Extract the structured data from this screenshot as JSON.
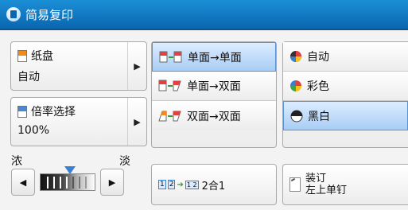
{
  "title": "简易复印",
  "paper": {
    "label": "纸盘",
    "value": "自动"
  },
  "ratio": {
    "label": "倍率选择",
    "value": "100%"
  },
  "sides": {
    "options": [
      {
        "label": "单面→单面",
        "selected": true
      },
      {
        "label": "单面→双面",
        "selected": false
      },
      {
        "label": "双面→双面",
        "selected": false
      }
    ]
  },
  "color": {
    "options": [
      {
        "label": "自动",
        "selected": false
      },
      {
        "label": "彩色",
        "selected": false
      },
      {
        "label": "黑白",
        "selected": true
      }
    ]
  },
  "density": {
    "dark_label": "浓",
    "light_label": "淡",
    "level_fraction": 0.43
  },
  "nup": {
    "icon_text_1": "1",
    "icon_text_2": "2",
    "icon_text_3": "1 2",
    "label": "2合1"
  },
  "staple": {
    "line1": "装订",
    "line2": "左上单钉"
  },
  "icons": {
    "left": "◀",
    "right": "▶"
  }
}
